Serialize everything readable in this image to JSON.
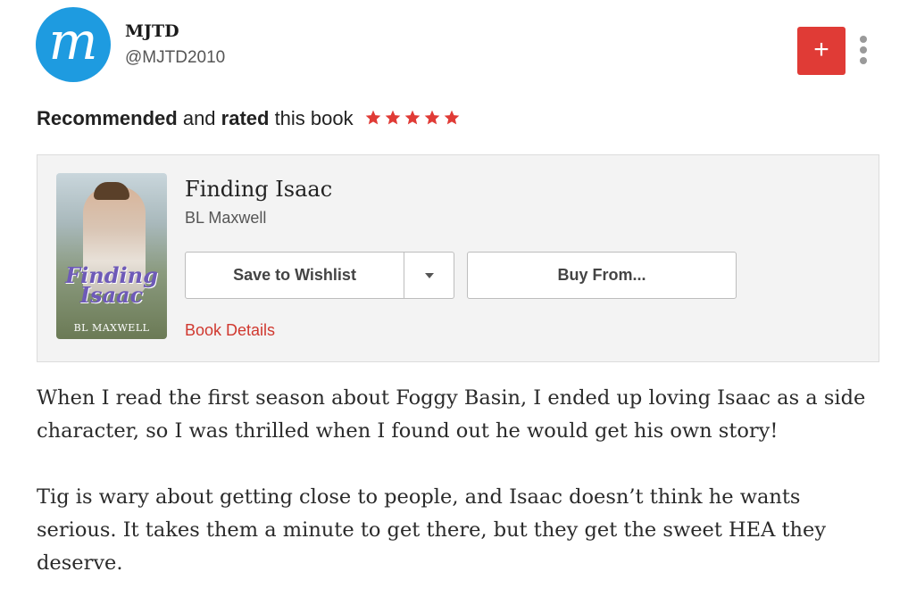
{
  "user": {
    "avatar_letter": "m",
    "name": "MJTD",
    "handle": "@MJTD2010"
  },
  "actions": {
    "add_label": "+"
  },
  "rating": {
    "recommended": "Recommended",
    "and": " and ",
    "rated": "rated",
    "this_book": " this book",
    "stars": 5,
    "max_stars": 5,
    "star_color": "#e03b36"
  },
  "book": {
    "cover_title": "Finding Isaac",
    "cover_author": "BL MAXWELL",
    "title": "Finding Isaac",
    "author": "BL Maxwell",
    "wishlist_label": "Save to Wishlist",
    "buy_label": "Buy From...",
    "details_label": "Book Details"
  },
  "review": {
    "paragraphs": [
      "When I read the first season about Foggy Basin, I ended up loving Isaac as a side character, so I was thrilled when I found out he would get his own story!",
      "Tig is wary about getting close to people, and Isaac doesn’t think he wants serious. It takes them a minute to get there, but they get the sweet HEA they deserve."
    ]
  },
  "colors": {
    "accent": "#e03b36",
    "avatar_bg": "#1e9be0",
    "link": "#d0382f"
  }
}
